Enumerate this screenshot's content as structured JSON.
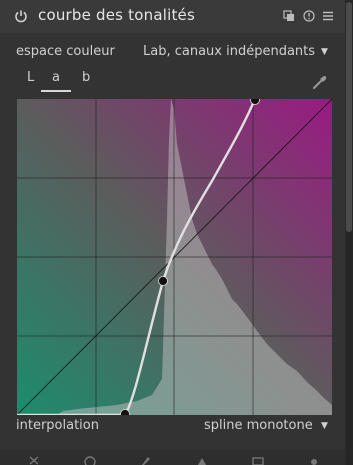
{
  "module": {
    "title": "courbe des tonalités",
    "icons": [
      "power-icon",
      "presets-icon",
      "reset-icon",
      "menu-icon"
    ]
  },
  "color_space": {
    "label": "espace couleur",
    "value": "Lab, canaux indépendants"
  },
  "tabs": [
    {
      "label": "L",
      "active": false
    },
    {
      "label": "a",
      "active": true
    },
    {
      "label": "b",
      "active": false
    }
  ],
  "picker_icon": "color-picker-icon",
  "curve": {
    "gradient_colors": {
      "low": "#1e8a6e",
      "high": "#a0197f"
    },
    "curve_color": "#e0e0e0",
    "node_color": "#111111"
  },
  "interpolation": {
    "label": "interpolation",
    "value": "spline monotone"
  },
  "colors": {
    "panel": "#333333",
    "header": "#3a3a3a",
    "text": "#d0d0d0"
  }
}
